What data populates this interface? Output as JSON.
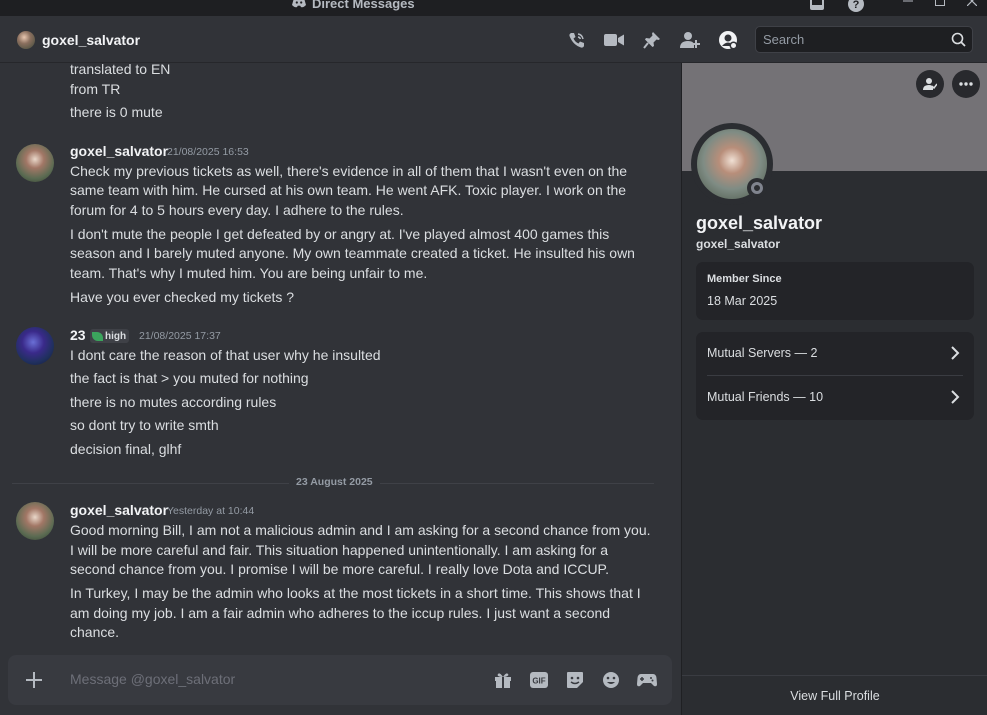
{
  "window": {
    "title": "Direct Messages"
  },
  "header": {
    "username": "goxel_salvator"
  },
  "search": {
    "placeholder": "Search"
  },
  "messages": {
    "top_lines": [
      "translated to EN",
      "from TR",
      "there is 0 mute"
    ],
    "m1": {
      "author": "goxel_salvator",
      "timestamp": "21/08/2025 16:53",
      "lines": [
        "Check my previous tickets as well, there's evidence in all of them that I wasn't even on the",
        "same team with him. He cursed at his own team. He went AFK. Toxic player. I work on the",
        "forum for 4 to 5 hours every day. I adhere to the rules.",
        "I don't mute the people I get defeated by or angry at. I've played almost 400 games this",
        "season and I barely muted anyone. My own teammate created a ticket. He insulted his own",
        "team. That's why I muted him. You are being unfair to me.",
        "Have you ever checked my tickets ?"
      ]
    },
    "m2": {
      "author": "23",
      "tag": "high",
      "timestamp": "21/08/2025 17:37",
      "lines": [
        "I dont care the reason of that user why he insulted",
        "the fact is that > you muted for nothing",
        "there is no mutes according rules",
        "so dont try to write smth",
        "decision final, glhf"
      ]
    },
    "divider": "23 August 2025",
    "m3": {
      "author": "goxel_salvator",
      "timestamp": "Yesterday at 10:44",
      "lines": [
        "Good morning Bill, I am not a malicious admin and I am asking for a second chance from you.",
        "I will be more careful and fair. This situation happened unintentionally. I am asking for a",
        "second chance from you. I promise I will be more careful. I really love Dota and ICCUP.",
        "In Turkey, I may be the admin who looks at the most tickets in a short time. This shows that I",
        "am doing my job. I am a fair admin who adheres to the iccup rules. I just want a second",
        "chance."
      ]
    }
  },
  "composer": {
    "placeholder": "Message @goxel_salvator"
  },
  "profile": {
    "display_name": "goxel_salvator",
    "username": "goxel_salvator",
    "member_since_label": "Member Since",
    "member_since": "18 Mar 2025",
    "mutual_servers": "Mutual Servers — 2",
    "mutual_friends": "Mutual Friends — 10",
    "view_full": "View Full Profile"
  },
  "colors": {
    "bg": "#313338",
    "panel": "#2b2d31",
    "accent_green": "#3ba55d"
  }
}
